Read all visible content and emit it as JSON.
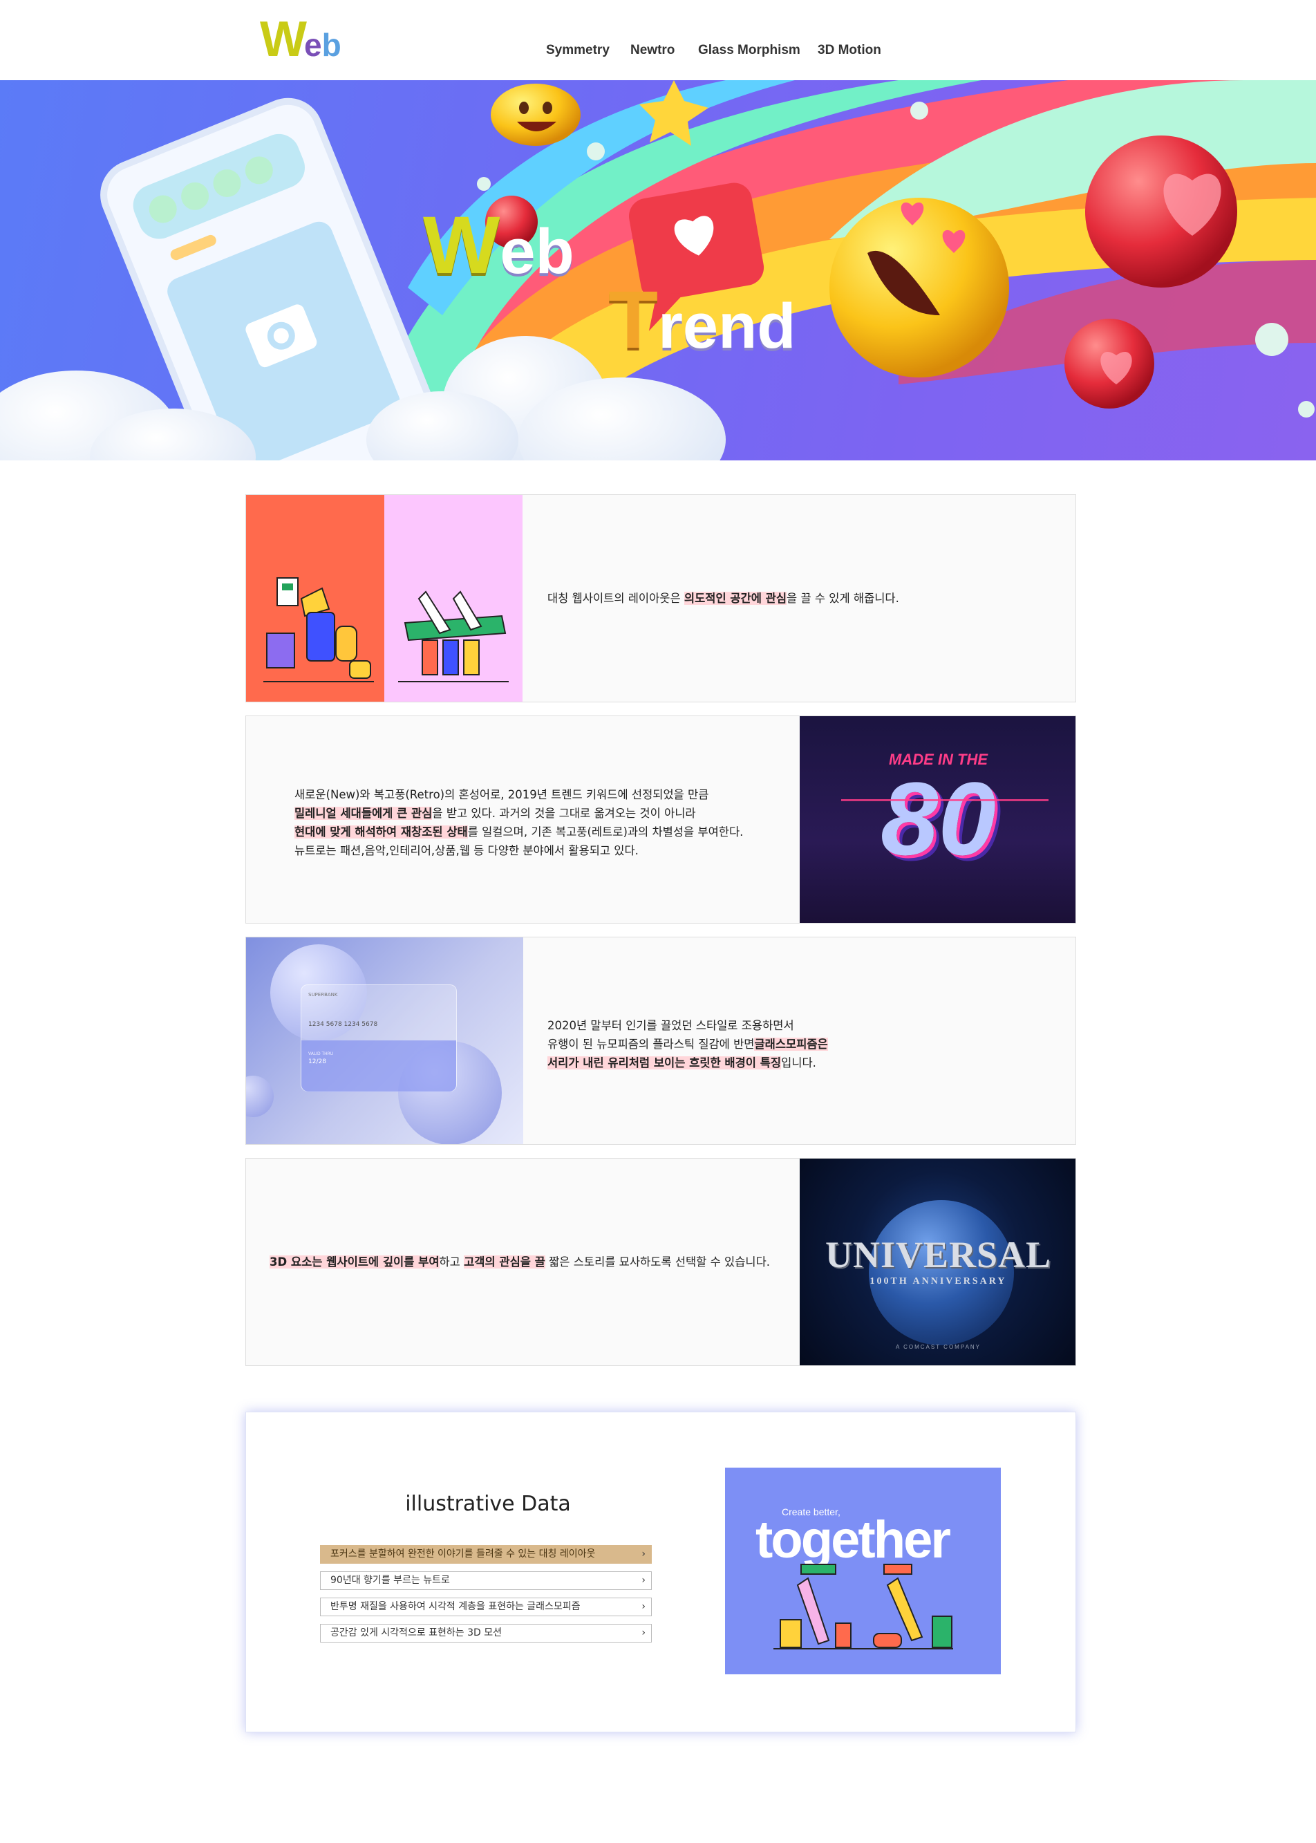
{
  "header": {
    "logo": {
      "w": "W",
      "e": "e",
      "b": "b"
    },
    "nav": [
      {
        "label": "Symmetry"
      },
      {
        "label": "Newtro"
      },
      {
        "label": "Glass Morphism"
      },
      {
        "label": "3D Motion"
      }
    ]
  },
  "hero": {
    "title_line1": {
      "cap": "W",
      "rest": "eb"
    },
    "title_line2": {
      "cap": "T",
      "rest": "rend"
    }
  },
  "sections": [
    {
      "id": "symmetry",
      "text": {
        "pre": "대칭 웹사이트의 레이아웃은 ",
        "hl": "의도적인 공간에 관심",
        "post": "을 끌 수 있게 해줍니다."
      }
    },
    {
      "id": "newtro",
      "lines": [
        {
          "pre": "새로운(New)와 복고풍(Retro)의 혼성어로, 2019년 트렌드 키워드에 선정되었을 만큼",
          "hl": "",
          "post": ""
        },
        {
          "pre": "",
          "hl": "밀레니얼 세대들에게 큰 관심",
          "post": "을 받고 있다. 과거의 것을 그대로 옮겨오는 것이 아니라"
        },
        {
          "pre": "",
          "hl": "현대에 맞게 해석하여 재창조된 상태",
          "post": "를 일컬으며, 기존 복고풍(레트로)과의 차별성을 부여한다."
        },
        {
          "pre": "뉴트로는 패션,음악,인테리어,상품,웹 등 다양한 분야에서 활용되고 있다.",
          "hl": "",
          "post": ""
        }
      ],
      "image": {
        "top": "MADE IN THE",
        "big": "80"
      }
    },
    {
      "id": "glass",
      "lines": [
        {
          "pre": "2020년 말부터 인기를 끌었던 스타일로 조용하면서",
          "hl": "",
          "post": ""
        },
        {
          "pre": "유행이 된 뉴모피즘의 플라스틱 질감에 반면",
          "hl": "글래스모피즘은",
          "post": ""
        },
        {
          "pre": "",
          "hl": "서리가 내린 유리처럼 보이는 흐릿한 배경이 특징",
          "post": "입니다."
        }
      ],
      "card": {
        "name": "SUPERBANK",
        "number": "1234 5678 1234 5678",
        "valid_label": "VALID THRU",
        "valid": "12/28"
      }
    },
    {
      "id": "3d",
      "text": {
        "hl1": "3D 요소는 웹사이트에 깊이를 부여",
        "mid": "하고 ",
        "hl2": "고객의 관심을 끌",
        "post": " 짧은 스토리를 묘사하도록 선택할 수 있습니다."
      },
      "image": {
        "brand": "UNIVERSAL",
        "sub": "100TH ANNIVERSARY",
        "foot": "A COMCAST COMPANY"
      }
    }
  ],
  "illustrative": {
    "title": "illustrative Data",
    "items": [
      {
        "label": "포커스를 분할하여 완전한 이야기를 들려줄 수 있는 대칭 레이아웃",
        "active": true
      },
      {
        "label": "90년대 향기를 부르는 뉴트로",
        "active": false
      },
      {
        "label": "반투명 재질을 사용하여 시각적 계층을 표현하는 글래스모피즘",
        "active": false
      },
      {
        "label": "공간감 있게 시각적으로 표현하는 3D 모션",
        "active": false
      }
    ],
    "chevron": "›",
    "image": {
      "small": "Create better,",
      "big": "together"
    }
  },
  "colors": {
    "highlight": "#ffd6da",
    "active_item": "#d9b98c",
    "hero_bg": "#6d6cf4"
  }
}
